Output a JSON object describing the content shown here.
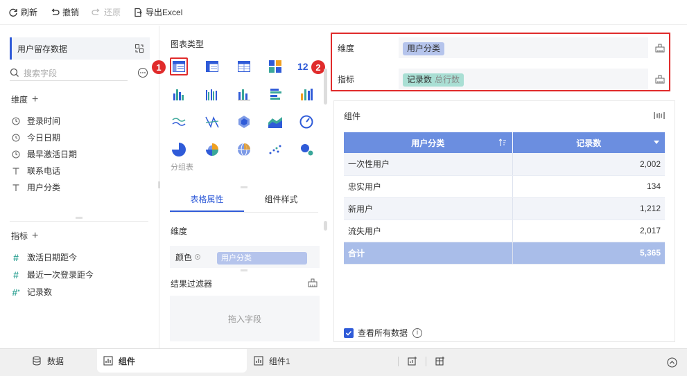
{
  "toolbar": {
    "refresh": "刷新",
    "undo": "撤销",
    "redo": "还原",
    "export": "导出Excel"
  },
  "left": {
    "dataset": "用户留存数据",
    "search_placeholder": "搜索字段",
    "dimension_title": "维度",
    "dimensions": [
      {
        "label": "登录时间",
        "icon": "clock-icon"
      },
      {
        "label": "今日日期",
        "icon": "clock-icon"
      },
      {
        "label": "最早激活日期",
        "icon": "clock-icon"
      },
      {
        "label": "联系电话",
        "icon": "text-icon"
      },
      {
        "label": "用户分类",
        "icon": "text-icon"
      }
    ],
    "measure_title": "指标",
    "measures": [
      {
        "label": "激活日期距今",
        "icon": "number-icon"
      },
      {
        "label": "最近一次登录距今",
        "icon": "number-icon"
      },
      {
        "label": "记录数",
        "icon": "number-star-icon"
      }
    ]
  },
  "middle": {
    "chart_type_title": "图表类型",
    "badge1": "1",
    "badge2": "2",
    "group_table_label": "分组表",
    "tab_table_props": "表格属性",
    "tab_component_style": "组件样式",
    "dimension_label": "维度",
    "color_label": "颜色",
    "color_field": "用户分类",
    "filter_title": "结果过滤器",
    "drop_placeholder": "拖入字段"
  },
  "right": {
    "dim_label": "维度",
    "dim_chip": "用户分类",
    "mea_label": "指标",
    "mea_chip": "记录数",
    "mea_chip_sub": "总行数",
    "component_title": "组件",
    "table": {
      "headers": [
        "用户分类",
        "记录数"
      ],
      "rows": [
        [
          "一次性用户",
          "2,002"
        ],
        [
          "忠实用户",
          "134"
        ],
        [
          "新用户",
          "1,212"
        ],
        [
          "流失用户",
          "2,017"
        ]
      ],
      "total": [
        "合计",
        "5,365"
      ]
    },
    "view_all": "查看所有数据"
  },
  "bottom": {
    "data_tab": "数据",
    "component_tab": "组件",
    "component1_tab": "组件1"
  },
  "colors": {
    "accent": "#2f5bd8",
    "highlight": "#e02b2b",
    "table_header": "#6b8ee0",
    "dim_chip": "#b5c4ec",
    "mea_chip": "#a9dfd4"
  }
}
